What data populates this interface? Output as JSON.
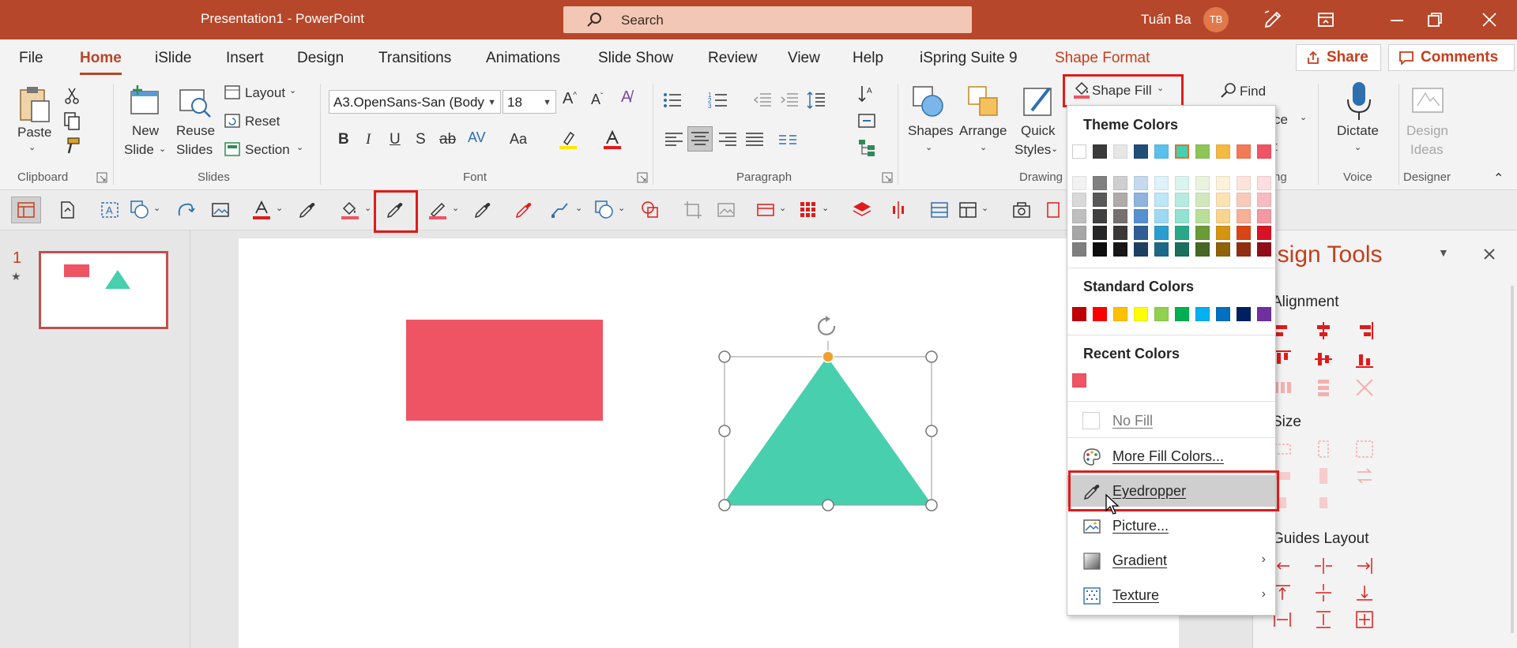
{
  "app": {
    "title": "Presentation1  -  PowerPoint",
    "search_placeholder": "Search",
    "user_name": "Tuấn Ba",
    "user_initials": "TB"
  },
  "tabs": [
    "File",
    "Home",
    "iSlide",
    "Insert",
    "Design",
    "Transitions",
    "Animations",
    "Slide Show",
    "Review",
    "View",
    "Help",
    "iSpring Suite 9",
    "Shape Format"
  ],
  "active_tab": "Home",
  "top_buttons": {
    "share": "Share",
    "comments": "Comments"
  },
  "ribbon": {
    "clipboard": {
      "paste": "Paste",
      "label": "Clipboard"
    },
    "slides": {
      "new_slide_1": "New",
      "new_slide_2": "Slide",
      "reuse_1": "Reuse",
      "reuse_2": "Slides",
      "layout": "Layout",
      "reset": "Reset",
      "section": "Section",
      "label": "Slides"
    },
    "font": {
      "font_name": "A3.OpenSans-San (Body",
      "font_size": "18",
      "label": "Font"
    },
    "paragraph": {
      "label": "Paragraph"
    },
    "drawing": {
      "shapes": "Shapes",
      "arrange": "Arrange",
      "quick_1": "Quick",
      "quick_2": "Styles",
      "shape_fill": "Shape Fill",
      "label": "Drawing"
    },
    "editing": {
      "find": "Find",
      "partial_1": "ce",
      "partial_2": "t",
      "partial_label": "ng"
    },
    "voice": {
      "dictate": "Dictate",
      "label": "Voice"
    },
    "designer": {
      "ideas_1": "Design",
      "ideas_2": "Ideas",
      "label": "Designer"
    }
  },
  "slide_panel": {
    "number": "1",
    "star": "★"
  },
  "design_tools": {
    "title": "esign Tools",
    "alignment": "Alignment",
    "size": "Size",
    "guides": "Guides Layout"
  },
  "dropdown": {
    "theme_header": "Theme Colors",
    "standard_header": "Standard Colors",
    "recent_header": "Recent Colors",
    "no_fill": "No Fill",
    "more_colors": "More Fill Colors...",
    "eyedropper": "Eyedropper",
    "picture": "Picture...",
    "gradient": "Gradient",
    "texture": "Texture",
    "theme_top_row": [
      "#ffffff",
      "#3a3a3a",
      "#e7e6e6",
      "#1f4e79",
      "#5bc0eb",
      "#48cfae",
      "#8dc657",
      "#f4b942",
      "#f27a54",
      "#ef5465"
    ],
    "theme_shades": [
      [
        "#f2f2f2",
        "#d9d9d9",
        "#bfbfbf",
        "#a6a6a6",
        "#7f7f7f"
      ],
      [
        "#808080",
        "#595959",
        "#404040",
        "#262626",
        "#0d0d0d"
      ],
      [
        "#d0cece",
        "#afabab",
        "#767171",
        "#3b3838",
        "#181717"
      ],
      [
        "#c5d9ef",
        "#8eb3df",
        "#5690ce",
        "#2e5e93",
        "#1e3f62"
      ],
      [
        "#def2fb",
        "#bde6f7",
        "#9dd9f3",
        "#2a9ecf",
        "#1c698a"
      ],
      [
        "#daf5ef",
        "#b5ecdf",
        "#91e2ce",
        "#2aa789",
        "#1c6f5b"
      ],
      [
        "#e8f4dd",
        "#d1e8bc",
        "#bbdd9a",
        "#699c36",
        "#466824"
      ],
      [
        "#fdf1d9",
        "#fbe3b3",
        "#f8d58e",
        "#d5950d",
        "#8e6309"
      ],
      [
        "#fce4dc",
        "#f9c9ba",
        "#f7af98",
        "#d84517",
        "#902e0f"
      ],
      [
        "#fcdde0",
        "#f8bbc1",
        "#f598a2",
        "#d71325",
        "#8f0d19"
      ]
    ],
    "standard": [
      "#c00000",
      "#ff0000",
      "#ffc000",
      "#ffff00",
      "#92d050",
      "#00b050",
      "#00b0f0",
      "#0070c0",
      "#002060",
      "#7030a0"
    ],
    "recent": [
      "#ef5465"
    ]
  },
  "slide_shapes": {
    "rectangle_color": "#ef5465",
    "triangle_color": "#48cfae"
  }
}
